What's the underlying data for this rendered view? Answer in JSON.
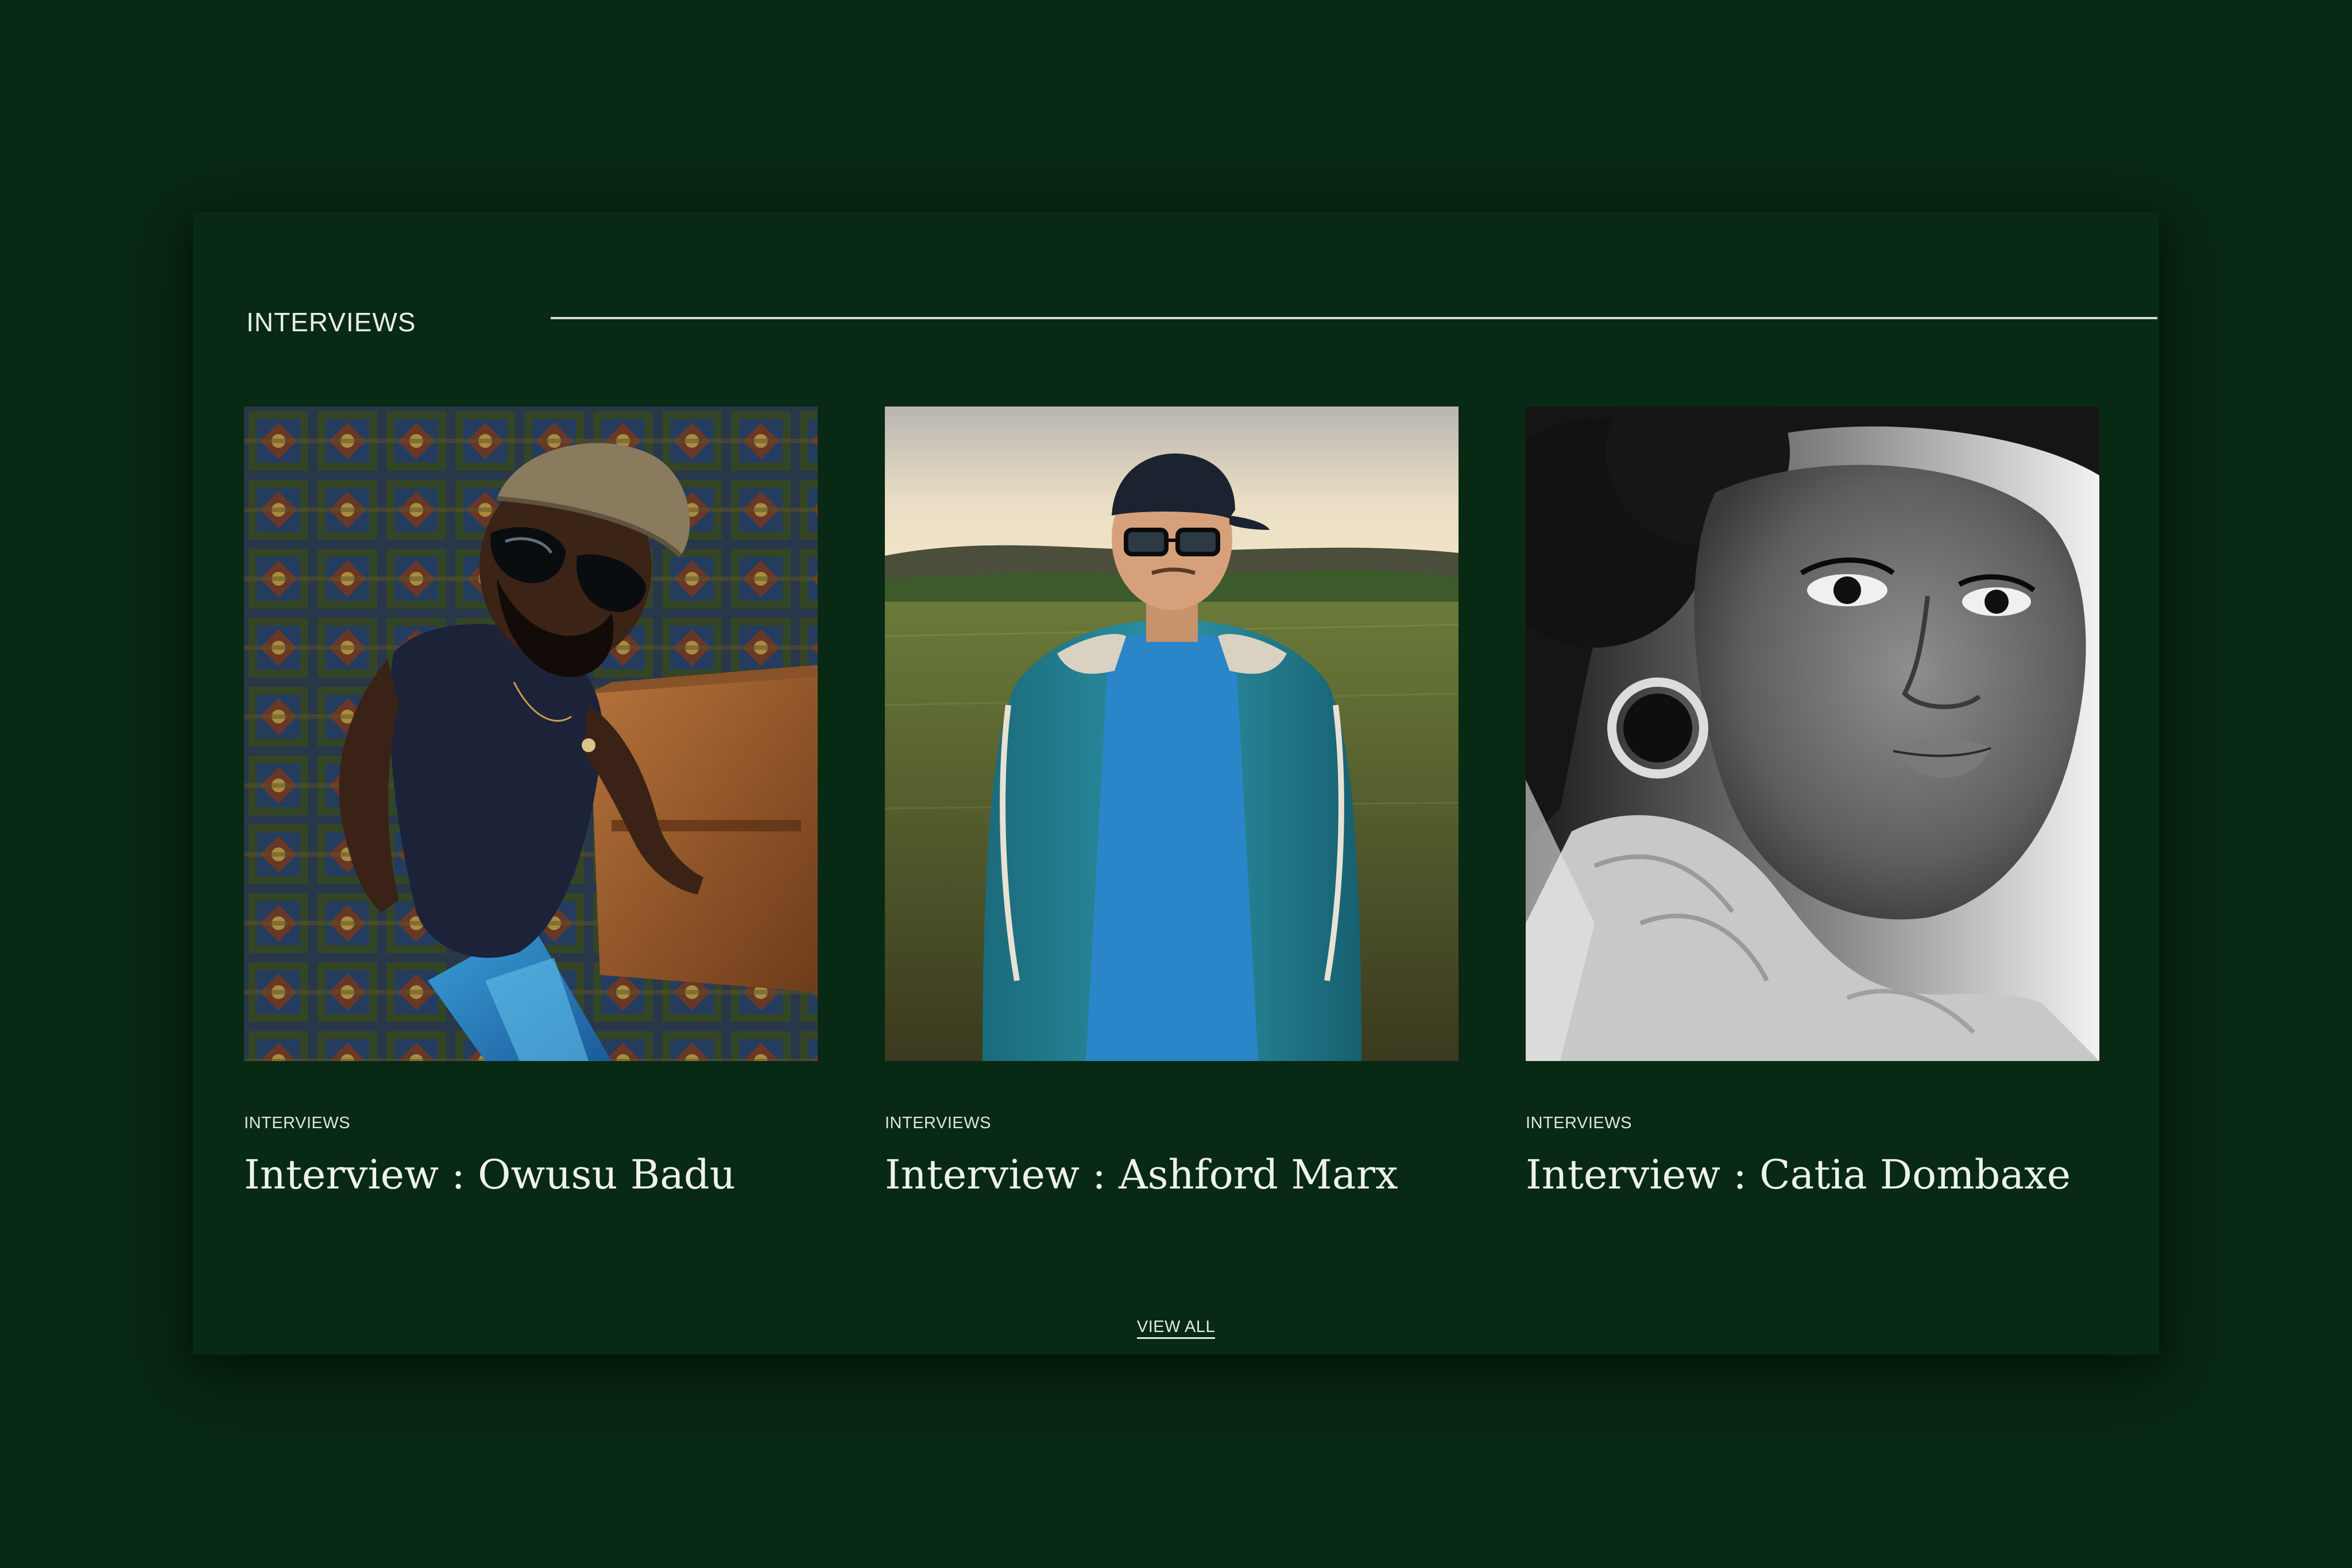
{
  "section": {
    "title": "INTERVIEWS"
  },
  "articles": [
    {
      "category": "INTERVIEWS",
      "headline": "Interview : Owusu Badu",
      "image_icon": "portrait-photo-icon"
    },
    {
      "category": "INTERVIEWS",
      "headline": "Interview : Ashford Marx",
      "image_icon": "portrait-photo-icon"
    },
    {
      "category": "INTERVIEWS",
      "headline": "Interview : Catia Dombaxe",
      "image_icon": "portrait-photo-icon"
    }
  ],
  "footer": {
    "view_all_label": "VIEW ALL"
  },
  "colors": {
    "background": "#082913",
    "text": "#eef2ec",
    "rule": "#d6ddd3"
  }
}
